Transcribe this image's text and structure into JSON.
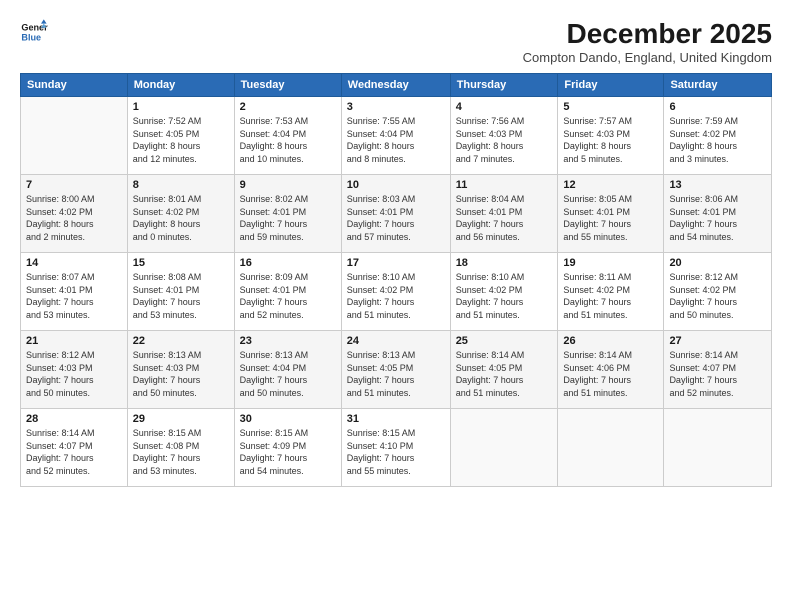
{
  "logo": {
    "line1": "General",
    "line2": "Blue"
  },
  "title": "December 2025",
  "location": "Compton Dando, England, United Kingdom",
  "weekdays": [
    "Sunday",
    "Monday",
    "Tuesday",
    "Wednesday",
    "Thursday",
    "Friday",
    "Saturday"
  ],
  "weeks": [
    [
      {
        "day": "",
        "info": ""
      },
      {
        "day": "1",
        "info": "Sunrise: 7:52 AM\nSunset: 4:05 PM\nDaylight: 8 hours\nand 12 minutes."
      },
      {
        "day": "2",
        "info": "Sunrise: 7:53 AM\nSunset: 4:04 PM\nDaylight: 8 hours\nand 10 minutes."
      },
      {
        "day": "3",
        "info": "Sunrise: 7:55 AM\nSunset: 4:04 PM\nDaylight: 8 hours\nand 8 minutes."
      },
      {
        "day": "4",
        "info": "Sunrise: 7:56 AM\nSunset: 4:03 PM\nDaylight: 8 hours\nand 7 minutes."
      },
      {
        "day": "5",
        "info": "Sunrise: 7:57 AM\nSunset: 4:03 PM\nDaylight: 8 hours\nand 5 minutes."
      },
      {
        "day": "6",
        "info": "Sunrise: 7:59 AM\nSunset: 4:02 PM\nDaylight: 8 hours\nand 3 minutes."
      }
    ],
    [
      {
        "day": "7",
        "info": "Sunrise: 8:00 AM\nSunset: 4:02 PM\nDaylight: 8 hours\nand 2 minutes."
      },
      {
        "day": "8",
        "info": "Sunrise: 8:01 AM\nSunset: 4:02 PM\nDaylight: 8 hours\nand 0 minutes."
      },
      {
        "day": "9",
        "info": "Sunrise: 8:02 AM\nSunset: 4:01 PM\nDaylight: 7 hours\nand 59 minutes."
      },
      {
        "day": "10",
        "info": "Sunrise: 8:03 AM\nSunset: 4:01 PM\nDaylight: 7 hours\nand 57 minutes."
      },
      {
        "day": "11",
        "info": "Sunrise: 8:04 AM\nSunset: 4:01 PM\nDaylight: 7 hours\nand 56 minutes."
      },
      {
        "day": "12",
        "info": "Sunrise: 8:05 AM\nSunset: 4:01 PM\nDaylight: 7 hours\nand 55 minutes."
      },
      {
        "day": "13",
        "info": "Sunrise: 8:06 AM\nSunset: 4:01 PM\nDaylight: 7 hours\nand 54 minutes."
      }
    ],
    [
      {
        "day": "14",
        "info": "Sunrise: 8:07 AM\nSunset: 4:01 PM\nDaylight: 7 hours\nand 53 minutes."
      },
      {
        "day": "15",
        "info": "Sunrise: 8:08 AM\nSunset: 4:01 PM\nDaylight: 7 hours\nand 53 minutes."
      },
      {
        "day": "16",
        "info": "Sunrise: 8:09 AM\nSunset: 4:01 PM\nDaylight: 7 hours\nand 52 minutes."
      },
      {
        "day": "17",
        "info": "Sunrise: 8:10 AM\nSunset: 4:02 PM\nDaylight: 7 hours\nand 51 minutes."
      },
      {
        "day": "18",
        "info": "Sunrise: 8:10 AM\nSunset: 4:02 PM\nDaylight: 7 hours\nand 51 minutes."
      },
      {
        "day": "19",
        "info": "Sunrise: 8:11 AM\nSunset: 4:02 PM\nDaylight: 7 hours\nand 51 minutes."
      },
      {
        "day": "20",
        "info": "Sunrise: 8:12 AM\nSunset: 4:02 PM\nDaylight: 7 hours\nand 50 minutes."
      }
    ],
    [
      {
        "day": "21",
        "info": "Sunrise: 8:12 AM\nSunset: 4:03 PM\nDaylight: 7 hours\nand 50 minutes."
      },
      {
        "day": "22",
        "info": "Sunrise: 8:13 AM\nSunset: 4:03 PM\nDaylight: 7 hours\nand 50 minutes."
      },
      {
        "day": "23",
        "info": "Sunrise: 8:13 AM\nSunset: 4:04 PM\nDaylight: 7 hours\nand 50 minutes."
      },
      {
        "day": "24",
        "info": "Sunrise: 8:13 AM\nSunset: 4:05 PM\nDaylight: 7 hours\nand 51 minutes."
      },
      {
        "day": "25",
        "info": "Sunrise: 8:14 AM\nSunset: 4:05 PM\nDaylight: 7 hours\nand 51 minutes."
      },
      {
        "day": "26",
        "info": "Sunrise: 8:14 AM\nSunset: 4:06 PM\nDaylight: 7 hours\nand 51 minutes."
      },
      {
        "day": "27",
        "info": "Sunrise: 8:14 AM\nSunset: 4:07 PM\nDaylight: 7 hours\nand 52 minutes."
      }
    ],
    [
      {
        "day": "28",
        "info": "Sunrise: 8:14 AM\nSunset: 4:07 PM\nDaylight: 7 hours\nand 52 minutes."
      },
      {
        "day": "29",
        "info": "Sunrise: 8:15 AM\nSunset: 4:08 PM\nDaylight: 7 hours\nand 53 minutes."
      },
      {
        "day": "30",
        "info": "Sunrise: 8:15 AM\nSunset: 4:09 PM\nDaylight: 7 hours\nand 54 minutes."
      },
      {
        "day": "31",
        "info": "Sunrise: 8:15 AM\nSunset: 4:10 PM\nDaylight: 7 hours\nand 55 minutes."
      },
      {
        "day": "",
        "info": ""
      },
      {
        "day": "",
        "info": ""
      },
      {
        "day": "",
        "info": ""
      }
    ]
  ]
}
